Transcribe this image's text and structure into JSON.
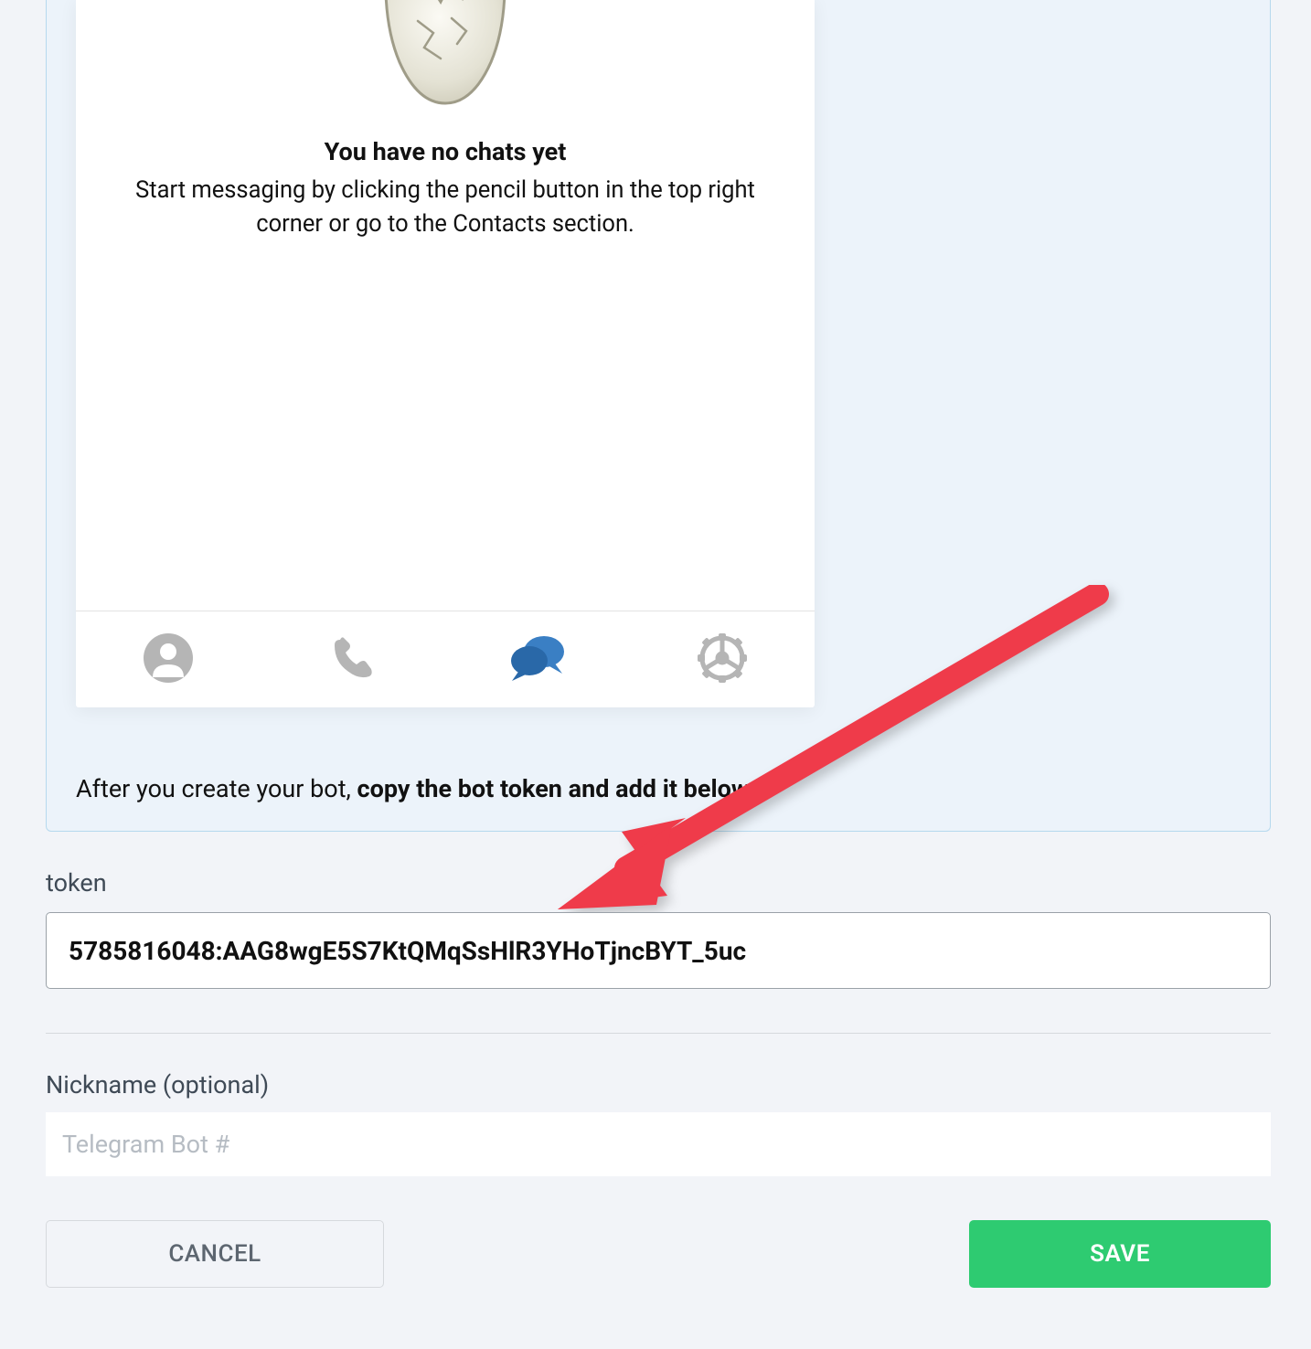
{
  "phone": {
    "empty_title": "You have no chats yet",
    "empty_subtitle": "Start messaging by clicking the pencil button in the top right corner or go to the Contacts section.",
    "tabs": {
      "contacts": "contacts",
      "calls": "calls",
      "chats": "chats",
      "settings": "settings"
    }
  },
  "instruction": {
    "prefix": "After you create your bot, ",
    "bold": "copy the bot token and add it below",
    "suffix": "."
  },
  "form": {
    "token_label": "token",
    "token_value": "5785816048:AAG8wgE5S7KtQMqSsHlR3YHoTjncBYT_5uc",
    "nickname_label": "Nickname (optional)",
    "nickname_placeholder": "Telegram Bot #",
    "nickname_value": ""
  },
  "buttons": {
    "cancel": "CANCEL",
    "save": "SAVE"
  },
  "colors": {
    "accent_blue": "#3a7fc4",
    "arrow_red": "#ef3b4a",
    "save_green": "#2ecb71"
  }
}
